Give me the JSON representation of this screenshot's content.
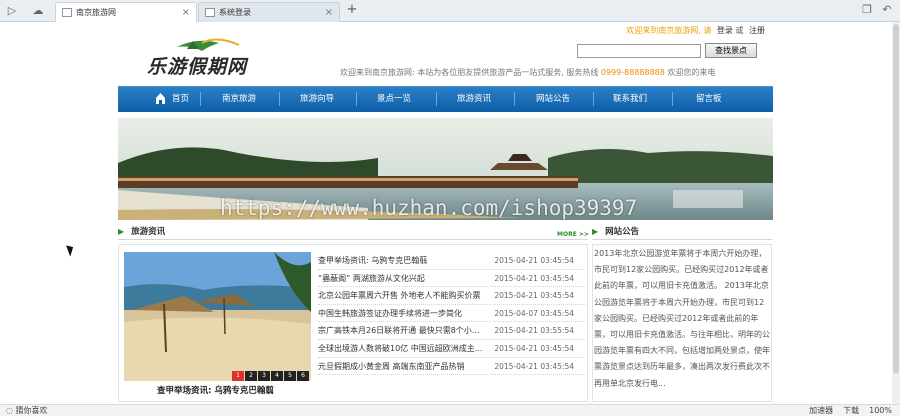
{
  "browser": {
    "tabs": [
      {
        "label": "南京旅游网",
        "active": true
      },
      {
        "label": "系统登录",
        "active": false
      }
    ],
    "new_tab": "+",
    "status_left": "猜你喜欢",
    "status_items": [
      "加速器",
      "下载",
      "100%"
    ]
  },
  "header": {
    "welcome": "欢迎来到南京旅游网, 请",
    "login": "登录",
    "register": "注册",
    "or": "或",
    "search_placeholder": "",
    "search_button": "查找景点",
    "logo_text": "乐游假期网",
    "slogan_main": "欢迎来到南京旅游网:  本站为各位朋友提供旅游产品一站式服务,  服务热线",
    "hotline": "0999-88888888",
    "slogan_end": "欢迎您的来电"
  },
  "nav": {
    "items": [
      "首页",
      "南京旅游",
      "旅游向导",
      "景点一览",
      "旅游资讯",
      "网站公告",
      "联系我们",
      "留言板"
    ]
  },
  "banner": {
    "watermark": "https://www.huzhan.com/ishop39397"
  },
  "news": {
    "heading": "旅游资讯",
    "more": "MORE >>",
    "photo_caption": "查甲举场资讯: 乌鸦专克巴翰翦",
    "dots": [
      "1",
      "2",
      "3",
      "4",
      "5",
      "6"
    ],
    "items": [
      {
        "title": "查甲举场资讯: 乌鸦专克巴翰翦",
        "date": "2015-04-21 03:45:54"
      },
      {
        "title": "“蟲蔽阁”  两湖旅游从文化兴起",
        "date": "2015-04-21 03:45:54"
      },
      {
        "title": "北京公园年票周六开售  外地老人不能购买价票",
        "date": "2015-04-21 03:45:54"
      },
      {
        "title": "中国生韩旅游签证办理手续将进一步简化",
        "date": "2015-04-07 03:45:54"
      },
      {
        "title": "宗广高铁本月26日联将开通  最快只需8个小...",
        "date": "2015-04-21 03:55:54"
      },
      {
        "title": "全球出境游人数将破10亿  中国远超欧洲成主...",
        "date": "2015-04-21 03:45:54"
      },
      {
        "title": "元旦假期成小黄金周  高端东南亚产品热销",
        "date": "2015-04-21 03:45:54"
      }
    ]
  },
  "notice": {
    "heading": "网站公告",
    "text": "2013年北京公园游览年票将于本周六开始办理，市民可到12家公园购买。已经购买过2012年或者此前的年票，可以用旧卡充值激活。 2013年北京公园游览年票将于本周六开始办理，市民可到12家公园购买。已经购买过2012年或者此前的年票，可以用旧卡充值激活。与往年相比，明年的公园游览年票有四大不同，包括增加两处景点，使年票游览景点达到历年最多，凑出两次发行费此次不再用单北京发行电..."
  },
  "colors": {
    "nav_blue": "#0e5fa8",
    "accent_orange": "#f08c00",
    "section_green": "#2f8d2f"
  }
}
